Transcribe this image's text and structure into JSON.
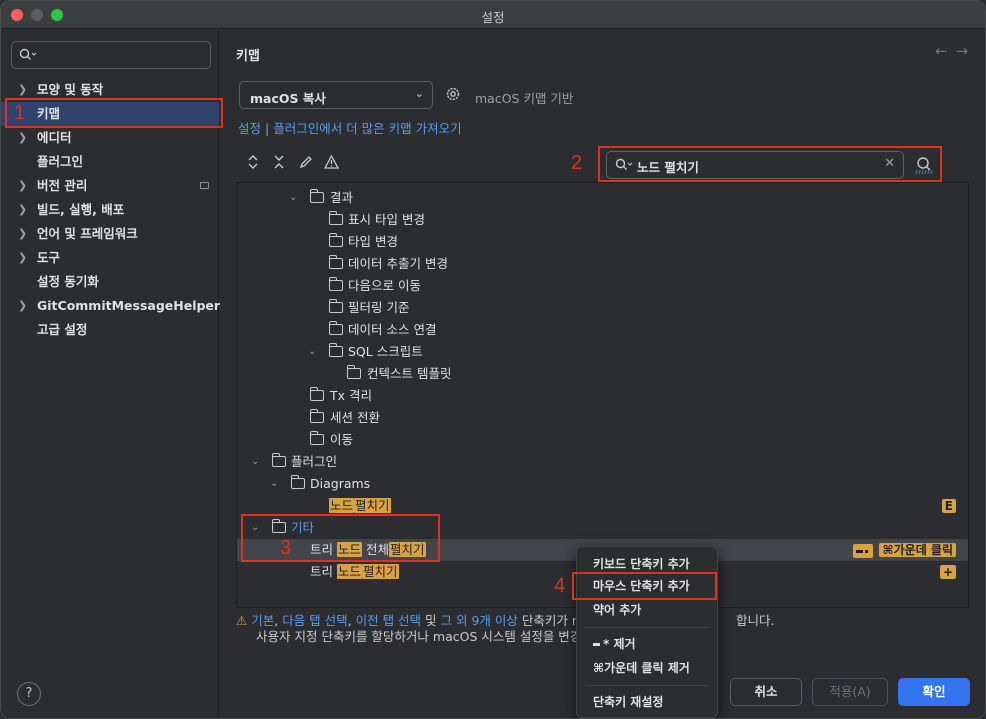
{
  "window": {
    "title": "설정"
  },
  "sidebar": {
    "search_placeholder": "",
    "items": [
      {
        "label": "모양 및 동작",
        "expandable": true
      },
      {
        "label": "키맵",
        "expandable": false,
        "selected": true
      },
      {
        "label": "에디터",
        "expandable": true
      },
      {
        "label": "플러그인",
        "expandable": false
      },
      {
        "label": "버전 관리",
        "expandable": true
      },
      {
        "label": "빌드, 실행, 배포",
        "expandable": true
      },
      {
        "label": "언어 및 프레임워크",
        "expandable": true
      },
      {
        "label": "도구",
        "expandable": true
      },
      {
        "label": "설정 동기화",
        "expandable": false
      },
      {
        "label": "GitCommitMessageHelper",
        "expandable": true
      },
      {
        "label": "고급 설정",
        "expandable": false
      }
    ],
    "help_label": "?"
  },
  "main": {
    "heading": "키맵",
    "nav_back": "←",
    "nav_forward": "→",
    "keymap_value": "macOS 복사",
    "based_on": "macOS 키맵 기반",
    "link_settings": "설정",
    "link_separator": " | ",
    "link_plugins": "플러그인에서 더 많은 키맵 가져오기",
    "search_value": "노드 펼치기",
    "tree": {
      "results": "결과",
      "show_type_change": "표시 타입 변경",
      "type_change": "타입 변경",
      "data_extractor_change": "데이터 추출기 변경",
      "move_next": "다음으로 이동",
      "filter_criteria": "필터링 기준",
      "data_source_connect": "데이터 소스 연결",
      "sql_scripts": "SQL 스크립트",
      "context_template": "컨텍스트 템플릿",
      "tx_isolation": "Tx 격리",
      "session_switch": "세션 전환",
      "move": "이동",
      "plugins": "플러그인",
      "diagrams": "Diagrams",
      "diag_node": "노드",
      "diag_expand": "펼치기",
      "diag_shortcut": "E",
      "other": "기타",
      "tree_prefix": "트리",
      "node": "노드",
      "whole": "전체",
      "expand": "펼치기",
      "mouse_shortcut": "⌘가운데 클릭",
      "row2_shortcut": "+"
    },
    "warning": {
      "icon": "⚠",
      "basic": "기본",
      "next_tab": "다음 탭 선택",
      "prev_tab": "이전 탭 선택",
      "and": "및",
      "more": "그 외 9개 이상",
      "text1": "단축키가 m",
      "text1_end": "합니다.",
      "text2": "사용자 지정 단축키를 할당하거나 macOS 시스템 설정을 변경하"
    },
    "buttons": {
      "cancel": "취소",
      "apply": "적용(A)",
      "ok": "확인"
    }
  },
  "context_menu": {
    "add_keyboard": "키보드 단축키 추가",
    "add_mouse": "마우스 단축키 추가",
    "add_abbrev": "약어 추가",
    "remove_dash": "* 제거",
    "remove_middle": "⌘가운데 클릭 제거",
    "reset": "단축키 재설정"
  },
  "annotations": {
    "n1": "1",
    "n2": "2",
    "n3": "3",
    "n4": "4"
  },
  "colors": {
    "accent": "#3574f0",
    "highlight": "#d9a343",
    "link": "#589df6",
    "annotation": "#e0311f",
    "selection": "#2e436e"
  }
}
